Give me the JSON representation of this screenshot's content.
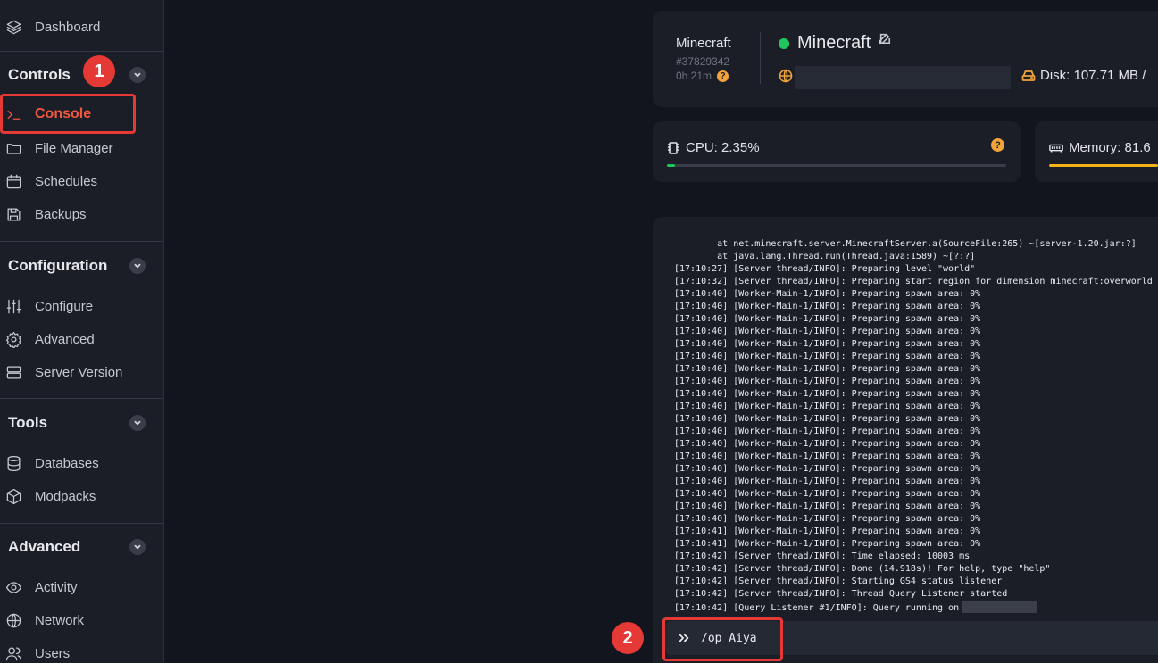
{
  "sidebar": {
    "dashboard": "Dashboard",
    "sections": {
      "controls": "Controls",
      "configuration": "Configuration",
      "tools": "Tools",
      "advanced": "Advanced"
    },
    "items": {
      "console": "Console",
      "file_manager": "File Manager",
      "schedules": "Schedules",
      "backups": "Backups",
      "configure": "Configure",
      "advanced": "Advanced",
      "server_version": "Server Version",
      "databases": "Databases",
      "modpacks": "Modpacks",
      "activity": "Activity",
      "network": "Network",
      "users": "Users"
    }
  },
  "annotations": {
    "step1": "1",
    "step2": "2"
  },
  "server": {
    "name_small": "Minecraft",
    "id": "#37829342",
    "uptime": "0h 21m",
    "help": "?",
    "title": "Minecraft",
    "status": "online",
    "disk": "Disk: 107.71 MB /"
  },
  "stats": {
    "cpu_label": "CPU: 2.35%",
    "cpu_percent": 2.35,
    "cpu_help": "?",
    "memory_label": "Memory: 81.6",
    "memory_fill_fraction": 1
  },
  "console": {
    "lines": [
      "        at net.minecraft.server.MinecraftServer.a(SourceFile:265) ~[server-1.20.jar:?]",
      "        at java.lang.Thread.run(Thread.java:1589) ~[?:?]",
      "[17:10:27] [Server thread/INFO]: Preparing level \"world\"",
      "[17:10:32] [Server thread/INFO]: Preparing start region for dimension minecraft:overworld",
      "[17:10:40] [Worker-Main-1/INFO]: Preparing spawn area: 0%",
      "[17:10:40] [Worker-Main-1/INFO]: Preparing spawn area: 0%",
      "[17:10:40] [Worker-Main-1/INFO]: Preparing spawn area: 0%",
      "[17:10:40] [Worker-Main-1/INFO]: Preparing spawn area: 0%",
      "[17:10:40] [Worker-Main-1/INFO]: Preparing spawn area: 0%",
      "[17:10:40] [Worker-Main-1/INFO]: Preparing spawn area: 0%",
      "[17:10:40] [Worker-Main-1/INFO]: Preparing spawn area: 0%",
      "[17:10:40] [Worker-Main-1/INFO]: Preparing spawn area: 0%",
      "[17:10:40] [Worker-Main-1/INFO]: Preparing spawn area: 0%",
      "[17:10:40] [Worker-Main-1/INFO]: Preparing spawn area: 0%",
      "[17:10:40] [Worker-Main-1/INFO]: Preparing spawn area: 0%",
      "[17:10:40] [Worker-Main-1/INFO]: Preparing spawn area: 0%",
      "[17:10:40] [Worker-Main-1/INFO]: Preparing spawn area: 0%",
      "[17:10:40] [Worker-Main-1/INFO]: Preparing spawn area: 0%",
      "[17:10:40] [Worker-Main-1/INFO]: Preparing spawn area: 0%",
      "[17:10:40] [Worker-Main-1/INFO]: Preparing spawn area: 0%",
      "[17:10:40] [Worker-Main-1/INFO]: Preparing spawn area: 0%",
      "[17:10:40] [Worker-Main-1/INFO]: Preparing spawn area: 0%",
      "[17:10:40] [Worker-Main-1/INFO]: Preparing spawn area: 0%",
      "[17:10:41] [Worker-Main-1/INFO]: Preparing spawn area: 0%",
      "[17:10:41] [Worker-Main-1/INFO]: Preparing spawn area: 0%",
      "[17:10:42] [Server thread/INFO]: Time elapsed: 10003 ms",
      "[17:10:42] [Server thread/INFO]: Done (14.918s)! For help, type \"help\"",
      "[17:10:42] [Server thread/INFO]: Starting GS4 status listener",
      "[17:10:42] [Server thread/INFO]: Thread Query Listener started",
      "[17:10:42] [Query Listener #1/INFO]: Query running on"
    ],
    "command": "/op Aiya"
  }
}
